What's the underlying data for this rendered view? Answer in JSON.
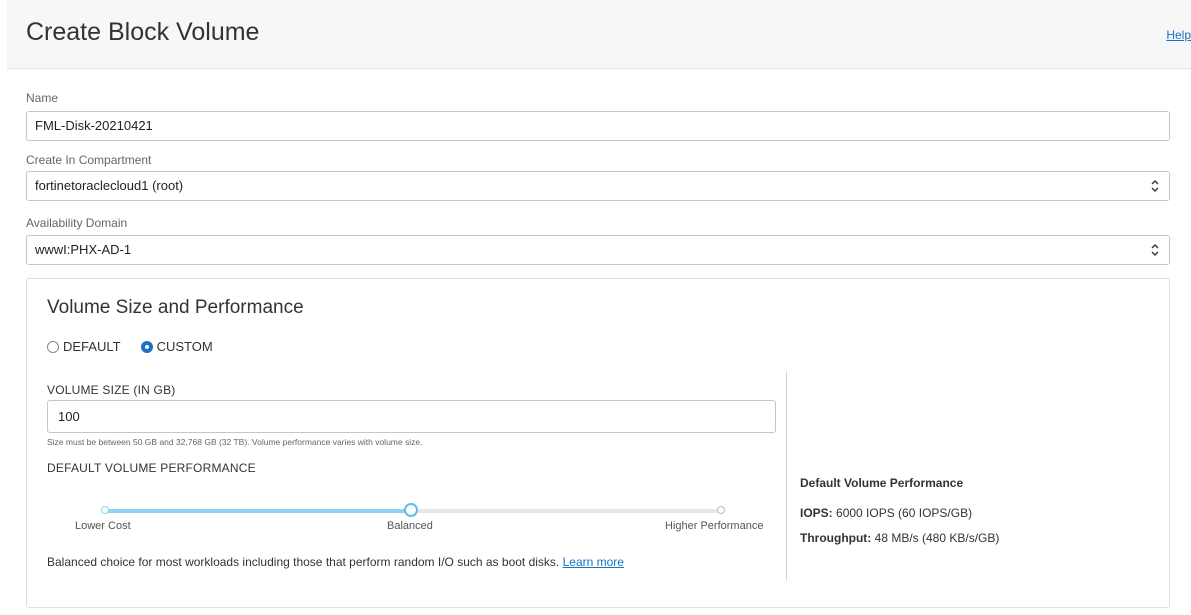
{
  "header": {
    "title": "Create Block Volume",
    "help": "Help"
  },
  "name": {
    "label": "Name",
    "value": "FML-Disk-20210421"
  },
  "compartment": {
    "label": "Create In Compartment",
    "value": "fortinetoraclecloud1 (root)"
  },
  "availability": {
    "label": "Availability Domain",
    "value": "wwwI:PHX-AD-1"
  },
  "volume": {
    "title": "Volume Size and Performance",
    "options": {
      "default": "DEFAULT",
      "custom": "CUSTOM",
      "selected": "CUSTOM"
    },
    "size_label": "VOLUME SIZE (IN GB)",
    "size_value": "100",
    "size_hint": "Size must be between 50 GB and 32,768 GB (32 TB). Volume performance varies with volume size.",
    "perf_label": "DEFAULT VOLUME PERFORMANCE",
    "slider": {
      "stops": [
        "Lower Cost",
        "Balanced",
        "Higher Performance"
      ],
      "selected": "Balanced"
    },
    "description": "Balanced choice for most workloads including those that perform random I/O such as boot disks.",
    "learn_more": "Learn more"
  },
  "summary": {
    "title": "Default Volume Performance",
    "iops_label": "IOPS:",
    "iops_value": "6000 IOPS (60 IOPS/GB)",
    "throughput_label": "Throughput:",
    "throughput_value": "48 MB/s (480 KB/s/GB)"
  },
  "colors": {
    "accent": "#1a73c9",
    "slider_fill": "#8fd3f0"
  }
}
